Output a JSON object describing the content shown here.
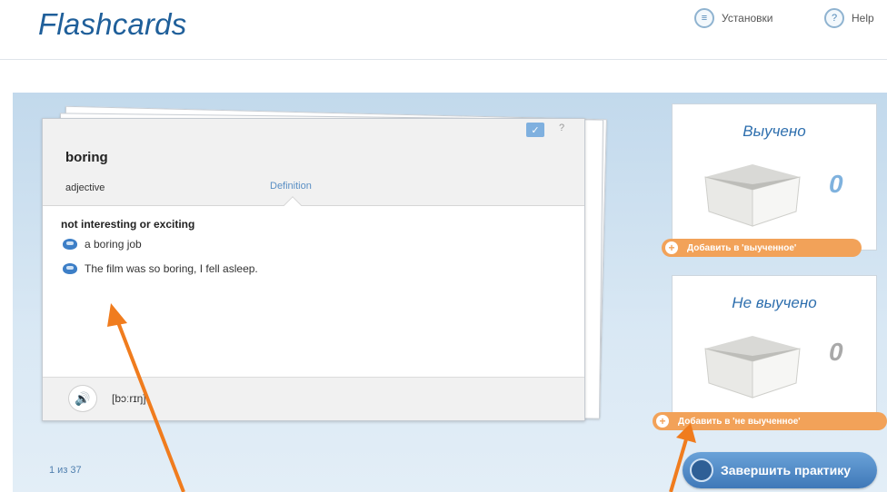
{
  "header": {
    "title": "Flashcards",
    "settings_label": "Установки",
    "help_label": "Help",
    "settings_icon": "settings-icon",
    "help_icon": "question-icon"
  },
  "card": {
    "term": "boring",
    "part_of_speech": "adjective",
    "definition_tab": "Definition",
    "definition": "not interesting or exciting",
    "examples": [
      "a boring job",
      "The film was so boring, I fell asleep."
    ],
    "pronunciation": "[bɔːrɪŋ]",
    "question_mark": "?"
  },
  "progress": {
    "counter": "1 из 37"
  },
  "learned": {
    "title": "Выучено",
    "count": "0",
    "add_label": "Добавить в 'выученное'"
  },
  "not_learned": {
    "title": "Не выучено",
    "count": "0",
    "add_label": "Добавить в 'не выученное'"
  },
  "finish": {
    "label": "Завершить практику"
  },
  "colors": {
    "title": "#1f5f9a",
    "accent_orange": "#f2a259",
    "accent_blue": "#3f78b8",
    "annotation_arrow": "#f07c1e"
  }
}
